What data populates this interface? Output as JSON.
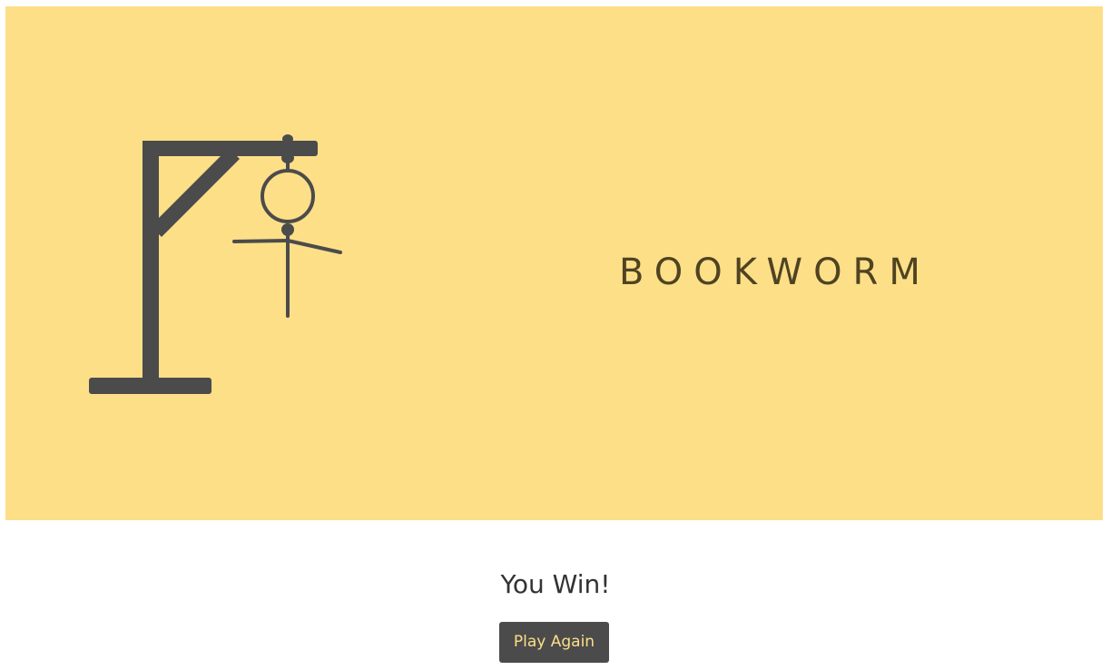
{
  "game": {
    "word": "BOOKWORM",
    "result_text": "You Win!",
    "play_again_label": "Play Again"
  },
  "colors": {
    "stage_background": "#fddf88",
    "gallows": "#4b4b4b",
    "word_text": "#4f4321",
    "button_text": "#fddf88",
    "button_background": "#4b4b4b"
  },
  "icons": {
    "gallows": "gallows-icon",
    "hangman": "stick-figure-icon"
  }
}
